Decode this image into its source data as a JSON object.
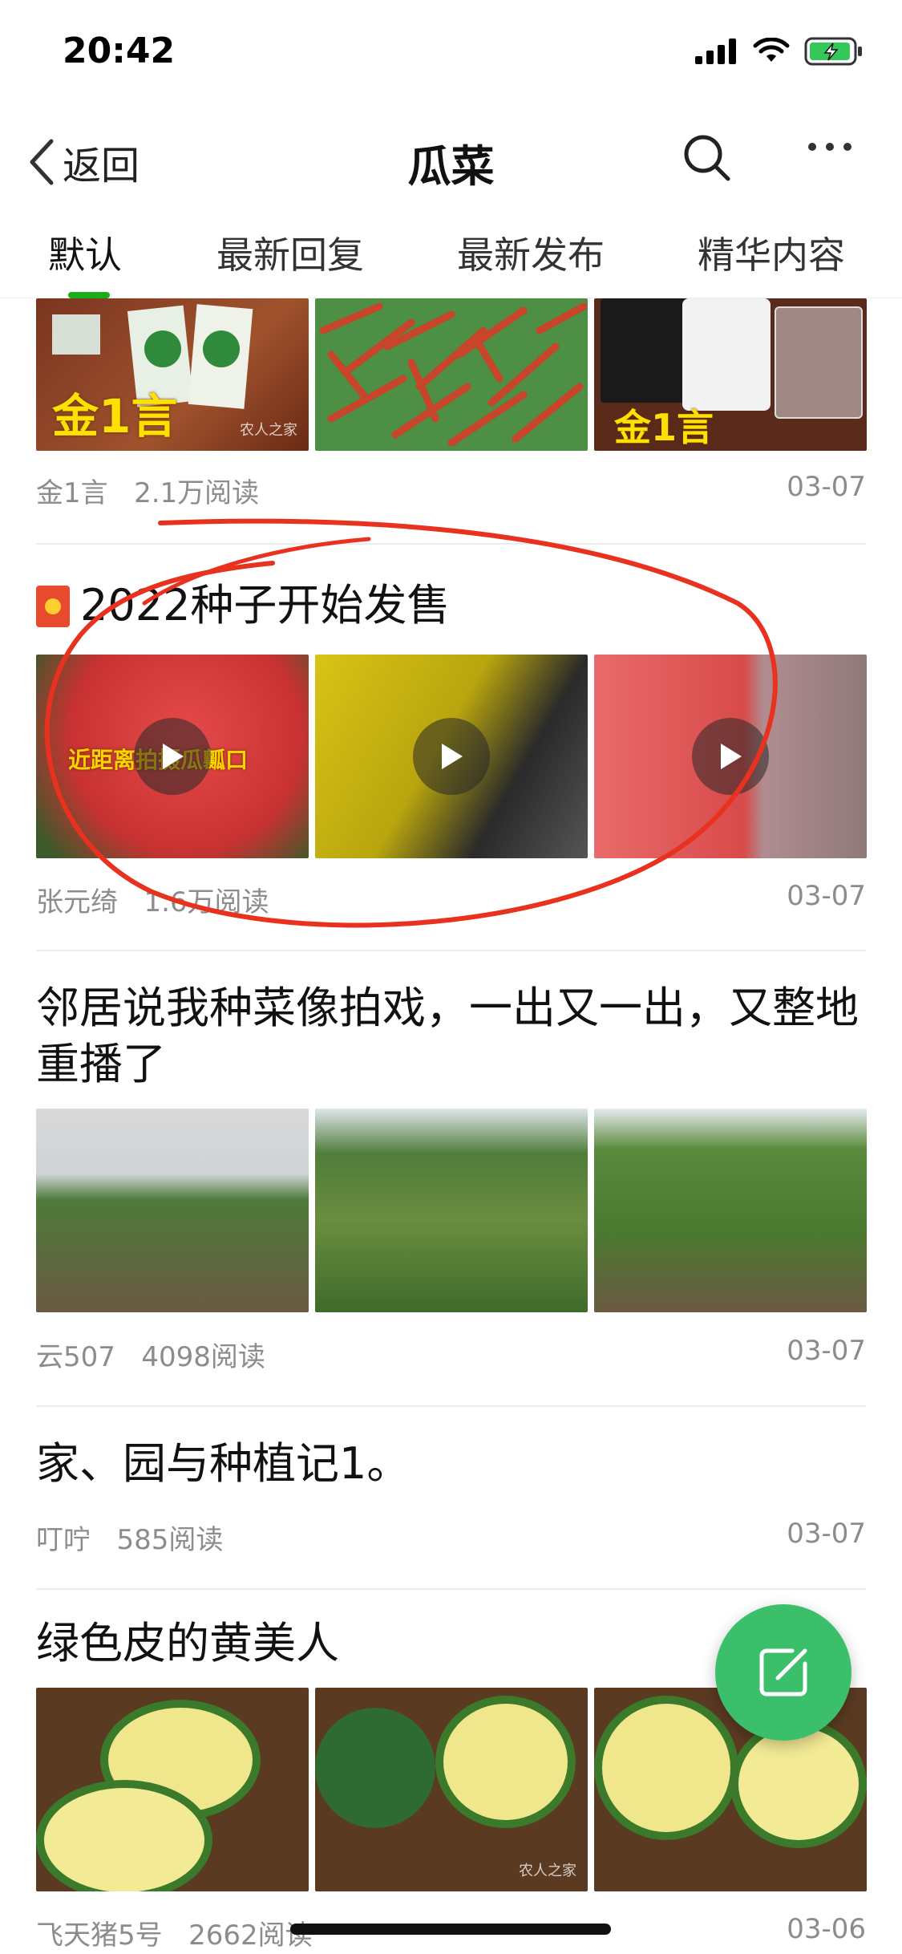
{
  "status": {
    "time": "20:42"
  },
  "nav": {
    "back_label": "返回",
    "title": "瓜菜"
  },
  "tabs": [
    "默认",
    "最新回复",
    "最新发布",
    "精华内容"
  ],
  "posts": [
    {
      "author": "金1言",
      "reads": "2.1万阅读",
      "date": "03-07",
      "overlay_1": "金1言",
      "overlay_3": "金1言",
      "watermark": "农人之家"
    },
    {
      "title": "2022种子开始发售",
      "author": "张元绮",
      "reads": "1.6万阅读",
      "date": "03-07",
      "video_caption": "近距离拍摄瓜瓤口"
    },
    {
      "title": "邻居说我种菜像拍戏，一出又一出，又整地重播了",
      "author": "云507",
      "reads": "4098阅读",
      "date": "03-07"
    },
    {
      "title": "家、园与种植记1。",
      "author": "叮咛",
      "reads": "585阅读",
      "date": "03-07"
    },
    {
      "title": "绿色皮的黄美人",
      "author": "飞天猪5号",
      "reads": "2662阅读",
      "date": "03-06",
      "watermark": "农人之家"
    }
  ],
  "icons": {
    "signal": "signal-icon",
    "wifi": "wifi-icon",
    "battery": "battery-charging-icon",
    "back": "chevron-left-icon",
    "search": "search-icon",
    "more": "more-dots-icon",
    "play": "play-icon",
    "compose": "compose-icon",
    "post_badge": "red-flag-badge-icon"
  },
  "colors": {
    "accent": "#1aad19",
    "fab": "#3cbf6b",
    "annotation": "#e8321f"
  }
}
